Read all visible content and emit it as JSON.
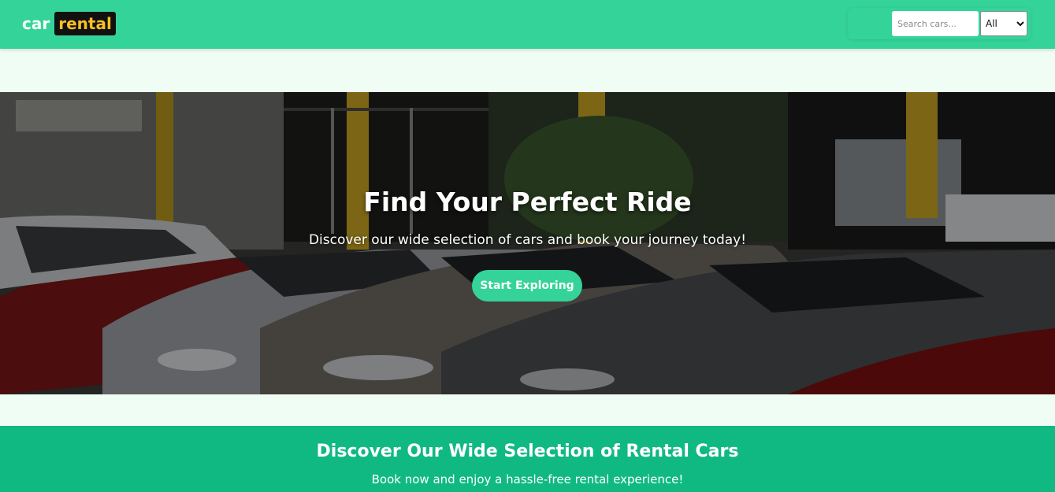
{
  "header": {
    "logo_part1": "car",
    "logo_part2": "rental",
    "search": {
      "placeholder": "Search cars...",
      "value": ""
    },
    "filter": {
      "selected": "All",
      "options": [
        "All"
      ]
    }
  },
  "hero": {
    "title": "Find Your Perfect Ride",
    "subtitle": "Discover our wide selection of cars and book your journey today!",
    "button_label": "Start Exploring",
    "background_image": "parked-cars-photo"
  },
  "banner": {
    "title": "Discover Our Wide Selection of Rental Cars",
    "subtitle": "Book now and enjoy a hassle-free rental experience!"
  },
  "colors": {
    "navbar": "#34d399",
    "banner": "#10b981",
    "page_background": "#f0fdf4",
    "logo_accent": "#fbbf24",
    "logo_box": "#111111"
  }
}
